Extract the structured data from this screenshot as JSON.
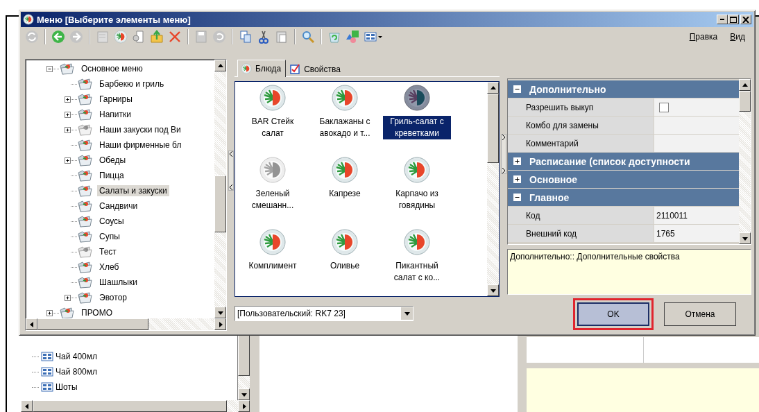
{
  "window": {
    "title": "Меню [Выберите элементы меню]"
  },
  "menus": [
    {
      "label": "Правка"
    },
    {
      "label": "Вид"
    }
  ],
  "tree": [
    {
      "label": "Основное меню",
      "expanded": true,
      "selected": false,
      "inactive": false,
      "children": [
        {
          "label": "Барбекю и гриль",
          "selected": false,
          "inactive": false
        },
        {
          "label": "Гарниры",
          "expanded": false,
          "selected": false,
          "inactive": false
        },
        {
          "label": "Напитки",
          "expanded": false,
          "selected": false,
          "inactive": false
        },
        {
          "label": "Наши закуски под Ви",
          "expanded": false,
          "selected": false,
          "inactive": true
        },
        {
          "label": "Наши фирменные бл",
          "selected": false,
          "inactive": false
        },
        {
          "label": "Обеды",
          "expanded": false,
          "selected": false,
          "inactive": false
        },
        {
          "label": "Пицца",
          "selected": false,
          "inactive": false
        },
        {
          "label": "Салаты и закуски",
          "selected": true,
          "inactive": false
        },
        {
          "label": "Сандвичи",
          "selected": false,
          "inactive": false
        },
        {
          "label": "Соусы",
          "selected": false,
          "inactive": false
        },
        {
          "label": "Супы",
          "selected": false,
          "inactive": false
        },
        {
          "label": "Тест",
          "selected": false,
          "inactive": true
        },
        {
          "label": "Хлеб",
          "selected": false,
          "inactive": false
        },
        {
          "label": "Шашлыки",
          "selected": false,
          "inactive": false
        },
        {
          "label": "Эвотор",
          "expanded": false,
          "selected": false,
          "inactive": false
        }
      ]
    },
    {
      "label": "ПРОМО",
      "expanded": false,
      "selected": false,
      "inactive": false
    }
  ],
  "tabs": [
    {
      "label": "Блюда",
      "selected": true
    },
    {
      "label": "Свойства",
      "selected": false
    }
  ],
  "dishes": [
    {
      "label": "BAR Стейк салат",
      "selected": false,
      "inactive": false
    },
    {
      "label": "Баклажаны с авокадо и т...",
      "selected": false,
      "inactive": false
    },
    {
      "label": "Гриль-салат с креветками",
      "selected": true,
      "inactive": false
    },
    {
      "label": "Зеленый смешанн...",
      "selected": false,
      "inactive": true
    },
    {
      "label": "Капрезе",
      "selected": false,
      "inactive": false
    },
    {
      "label": "Карпачо из говядины",
      "selected": false,
      "inactive": false
    },
    {
      "label": "Комплимент",
      "selected": false,
      "inactive": false
    },
    {
      "label": "Оливье",
      "selected": false,
      "inactive": false
    },
    {
      "label": "Пикантный салат с ко...",
      "selected": false,
      "inactive": false
    }
  ],
  "combo": {
    "value": "[Пользовательский: RK7 23]"
  },
  "properties": [
    {
      "title": "Дополнительно",
      "expanded": true,
      "rows": [
        {
          "name": "Разрешить выкуп",
          "kind": "checkbox",
          "checked": false
        },
        {
          "name": "Комбо для замены",
          "kind": "text"
        },
        {
          "name": "Комментарий",
          "kind": "text"
        }
      ]
    },
    {
      "title": "Расписание (список доступности",
      "expanded": false
    },
    {
      "title": "Основное",
      "expanded": false
    },
    {
      "title": "Главное",
      "expanded": true,
      "rows": [
        {
          "name": "Код",
          "kind": "text",
          "value": "2110011"
        },
        {
          "name": "Внешний код",
          "kind": "text",
          "value": "1765"
        }
      ]
    }
  ],
  "description": "Дополнительно:: Дополнительные свойства",
  "buttons": [
    {
      "label": "OK",
      "default": true,
      "annotated": true
    },
    {
      "label": "Отмена",
      "default": false,
      "annotated": false
    }
  ],
  "background": {
    "tree": [
      {
        "label": "Чай 400мл"
      },
      {
        "label": "Чай 800мл"
      },
      {
        "label": "Шоты"
      }
    ]
  }
}
